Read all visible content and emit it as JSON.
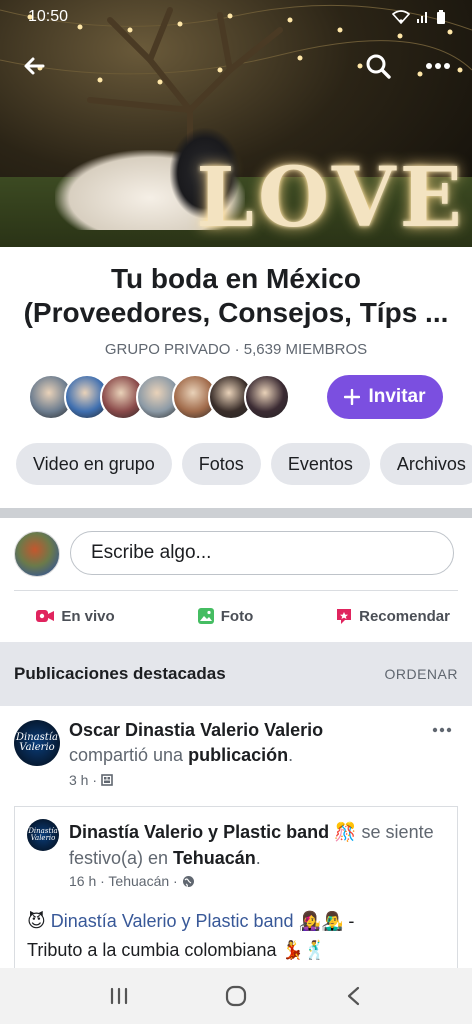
{
  "status": {
    "time": "10:50"
  },
  "cover": {
    "sign_text": "LOVE"
  },
  "group": {
    "title_line1": "Tu boda en México",
    "title_line2": "(Proveedores, Consejos, Típs ...",
    "meta": "GRUPO PRIVADO · 5,639 MIEMBROS",
    "invite_label": "Invitar",
    "member_colors": [
      "#6d7d8f",
      "#3f6fb0",
      "#8a4a4a",
      "#8c9aa6",
      "#a06a4a",
      "#3a2e2a",
      "#3b2b33"
    ]
  },
  "tabs": [
    "Video en grupo",
    "Fotos",
    "Eventos",
    "Archivos"
  ],
  "composer": {
    "placeholder": "Escribe algo...",
    "actions": [
      {
        "label": "En vivo",
        "icon": "live-video-icon",
        "color": "#e0245e"
      },
      {
        "label": "Foto",
        "icon": "photo-icon",
        "color": "#45bd62"
      },
      {
        "label": "Recomendar",
        "icon": "recommend-icon",
        "color": "#e0245e"
      }
    ]
  },
  "featured": {
    "title": "Publicaciones destacadas",
    "order_label": "ORDENAR"
  },
  "post": {
    "avatar_text": "Dinastía Valerio",
    "author": "Oscar Dinastia Valerio Valerio",
    "action_prefix": "compartió una ",
    "action_object": "publicación",
    "action_suffix": ".",
    "time": "3 h ·",
    "shared": {
      "avatar_text": "Dinastía Valerio",
      "author": "Dinastía Valerio y Plastic band",
      "feeling_emoji": "🎊",
      "feeling_prefix": " se siente festivo(a) en ",
      "place": "Tehuacán",
      "place_suffix": ".",
      "time": "16 h · Tehuacán ·",
      "body_emoji_start": "😈",
      "body_link": "Dinastía Valerio y Plastic band",
      "body_emoji_mid": "👩‍🎤👨‍🎤",
      "body_dash": " -",
      "body_text": "Tributo a la cumbia colombiana",
      "body_emoji_end": "💃🕺"
    }
  }
}
